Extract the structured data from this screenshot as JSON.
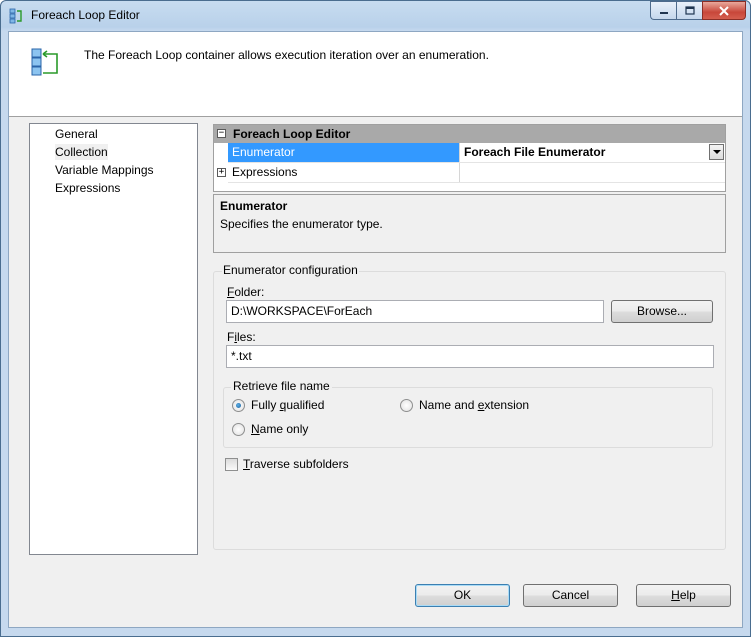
{
  "window": {
    "title": "Foreach Loop Editor"
  },
  "header": {
    "description": "The Foreach Loop container allows execution iteration over an enumeration."
  },
  "nav": {
    "items": [
      "General",
      "Collection",
      "Variable Mappings",
      "Expressions"
    ],
    "selected": "Collection"
  },
  "grid": {
    "category": "Foreach Loop Editor",
    "rows": [
      {
        "name": "Enumerator",
        "value": "Foreach File Enumerator"
      },
      {
        "name": "Expressions",
        "value": ""
      }
    ]
  },
  "description": {
    "title": "Enumerator",
    "text": "Specifies the enumerator type."
  },
  "config": {
    "legend": "Enumerator configuration",
    "folder_label_key": "F",
    "folder_label_rest": "older:",
    "folder_value": "D:\\WORKSPACE\\ForEach",
    "browse_label": "Browse...",
    "files_label_key": "F",
    "files_label_key2": "i",
    "files_label_rest": "les:",
    "files_value": "*.txt",
    "retrieve_legend": "Retrieve file name",
    "options": {
      "fully_qualified": {
        "pre": "Fully ",
        "key": "q",
        "post": "ualified"
      },
      "name_extension": {
        "pre": "Name and ",
        "key": "e",
        "post": "xtension"
      },
      "name_only": {
        "pre": "",
        "key": "N",
        "post": "ame only"
      }
    },
    "selected_option": "fully_qualified",
    "traverse": {
      "key": "T",
      "post": "raverse subfolders",
      "checked": false
    }
  },
  "buttons": {
    "ok": "OK",
    "cancel": "Cancel",
    "help_key": "H",
    "help_rest": "elp"
  },
  "colors": {
    "selection": "#3399ff",
    "category_bg": "#a9a9a9",
    "dialog_bg": "#f0f0f0"
  }
}
